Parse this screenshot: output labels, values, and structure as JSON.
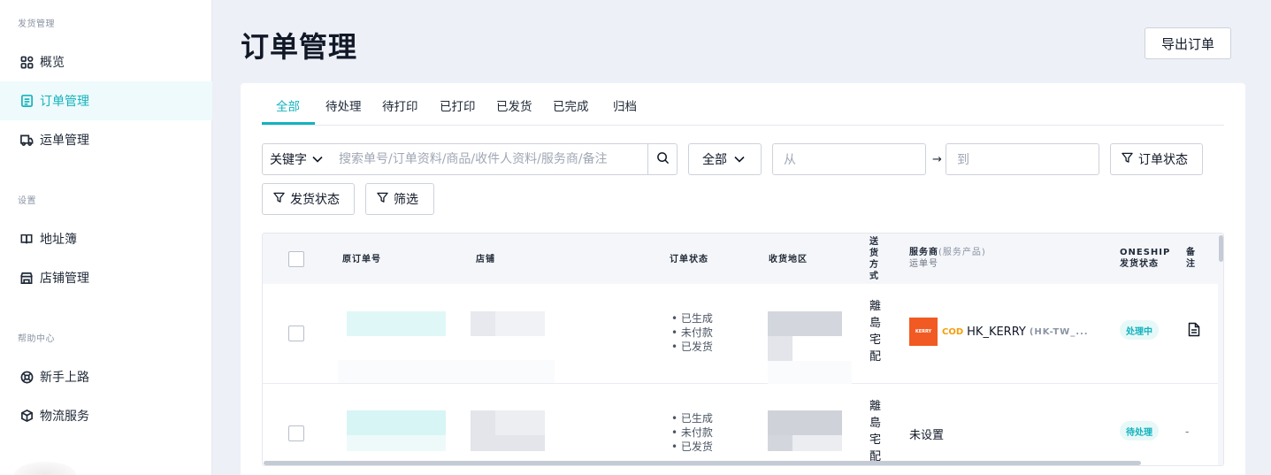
{
  "sidebar": {
    "sections": [
      {
        "title": "发货管理",
        "items": [
          {
            "label": "概览",
            "icon": "grid-icon",
            "active": false
          },
          {
            "label": "订单管理",
            "icon": "order-list-icon",
            "active": true
          },
          {
            "label": "运单管理",
            "icon": "truck-icon",
            "active": false
          }
        ]
      },
      {
        "title": "设置",
        "items": [
          {
            "label": "地址簿",
            "icon": "book-icon",
            "active": false
          },
          {
            "label": "店铺管理",
            "icon": "store-icon",
            "active": false
          }
        ]
      },
      {
        "title": "帮助中心",
        "items": [
          {
            "label": "新手上路",
            "icon": "lifebuoy-icon",
            "active": false
          },
          {
            "label": "物流服务",
            "icon": "package-icon",
            "active": false
          }
        ]
      }
    ]
  },
  "header": {
    "title": "订单管理",
    "export_label": "导出订单"
  },
  "tabs": [
    "全部",
    "待处理",
    "待打印",
    "已打印",
    "已发货",
    "已完成",
    "归档"
  ],
  "active_tab": "全部",
  "filters": {
    "keyword_select": "关键字",
    "search_placeholder": "搜索单号/订单资料/商品/收件人资料/服务商/备注",
    "scope_select": "全部",
    "date_from_placeholder": "从",
    "date_arrow": "→",
    "date_to_placeholder": "到",
    "order_status_label": "订单状态",
    "ship_status_label": "发货状态",
    "filter_label": "筛选"
  },
  "table": {
    "headers": {
      "order_no": "原订单号",
      "store": "店铺",
      "order_status": "订单状态",
      "region": "收货地区",
      "delivery": "送货方式",
      "provider": "服务商",
      "provider_sub": "(服务产品)",
      "waybill": "运单号",
      "oneship": "ONESHIP",
      "ship_status": "发货状态",
      "note": "备注"
    },
    "rows": [
      {
        "statuses": [
          "已生成",
          "未付款",
          "已发货"
        ],
        "delivery": "離島宅配",
        "provider": {
          "cod": "COD",
          "name": "HK_KERRY",
          "product": "(HK-TW_...",
          "logo_text": "KERRY"
        },
        "ship_status": "处理中",
        "note": "document-icon"
      },
      {
        "statuses": [
          "已生成",
          "未付款",
          "已发货"
        ],
        "delivery": "離島宅配",
        "provider_unset": "未设置",
        "ship_status": "待处理",
        "note_text": "-"
      }
    ]
  },
  "colors": {
    "accent": "#13b3bd",
    "kerry_orange": "#f15a22",
    "cod_orange": "#f59e0b"
  }
}
